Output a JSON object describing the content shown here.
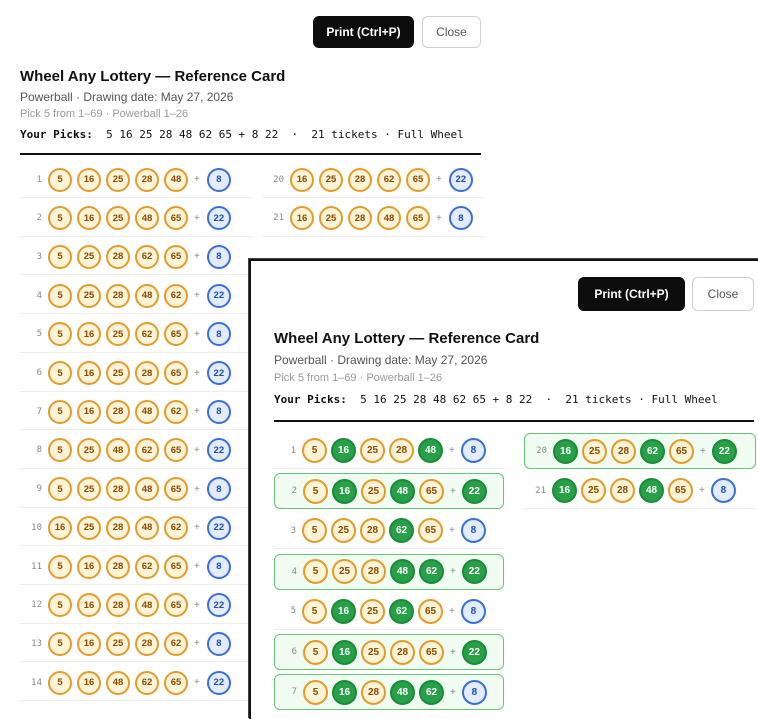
{
  "toolbar": {
    "print_label": "Print (Ctrl+P)",
    "close_label": "Close"
  },
  "card": {
    "title": "Wheel Any Lottery — Reference Card",
    "subtitle": "Powerball · Drawing date: May 27, 2026",
    "rules": "Pick 5 from 1–69 · Powerball 1–26",
    "picks_label": "Your Picks:",
    "picks_value": "5 16 25 28 48 62 65 + 8 22",
    "picks_suffix": "·  21 tickets · Full Wheel"
  },
  "colors": {
    "white_ball_fill": "#fdf3d6",
    "white_ball_border": "#e19c2c",
    "match_ball_fill": "#27a048",
    "powerball_fill": "#e2ecfd",
    "powerball_border": "#3b6ed8",
    "highlight_border": "#6cc27a"
  },
  "back_tickets": [
    {
      "n": "1",
      "balls": [
        "5",
        "16",
        "25",
        "28",
        "48"
      ],
      "pb": "8"
    },
    {
      "n": "2",
      "balls": [
        "5",
        "16",
        "25",
        "48",
        "65"
      ],
      "pb": "22"
    },
    {
      "n": "3",
      "balls": [
        "5",
        "25",
        "28",
        "62",
        "65"
      ],
      "pb": "8"
    },
    {
      "n": "4",
      "balls": [
        "5",
        "25",
        "28",
        "48",
        "62"
      ],
      "pb": "22"
    },
    {
      "n": "5",
      "balls": [
        "5",
        "16",
        "25",
        "62",
        "65"
      ],
      "pb": "8"
    },
    {
      "n": "6",
      "balls": [
        "5",
        "16",
        "25",
        "28",
        "65"
      ],
      "pb": "22"
    },
    {
      "n": "7",
      "balls": [
        "5",
        "16",
        "28",
        "48",
        "62"
      ],
      "pb": "8"
    },
    {
      "n": "8",
      "balls": [
        "5",
        "25",
        "48",
        "62",
        "65"
      ],
      "pb": "22"
    },
    {
      "n": "9",
      "balls": [
        "5",
        "25",
        "28",
        "48",
        "65"
      ],
      "pb": "8"
    },
    {
      "n": "10",
      "balls": [
        "16",
        "25",
        "28",
        "48",
        "62"
      ],
      "pb": "22"
    },
    {
      "n": "11",
      "balls": [
        "5",
        "16",
        "28",
        "62",
        "65"
      ],
      "pb": "8"
    },
    {
      "n": "12",
      "balls": [
        "5",
        "16",
        "28",
        "48",
        "65"
      ],
      "pb": "22"
    },
    {
      "n": "13",
      "balls": [
        "5",
        "16",
        "25",
        "28",
        "62"
      ],
      "pb": "8"
    },
    {
      "n": "14",
      "balls": [
        "5",
        "16",
        "48",
        "62",
        "65"
      ],
      "pb": "22"
    }
  ],
  "back_tickets_col2": [
    {
      "n": "20",
      "balls": [
        "16",
        "25",
        "28",
        "62",
        "65"
      ],
      "pb": "22"
    },
    {
      "n": "21",
      "balls": [
        "16",
        "25",
        "28",
        "48",
        "65"
      ],
      "pb": "8"
    }
  ],
  "front_tickets": [
    {
      "n": "1",
      "balls": [
        {
          "v": "5",
          "m": false
        },
        {
          "v": "16",
          "m": true
        },
        {
          "v": "25",
          "m": false
        },
        {
          "v": "28",
          "m": false
        },
        {
          "v": "48",
          "m": true
        }
      ],
      "pb": "8",
      "pbm": false,
      "hl": false
    },
    {
      "n": "2",
      "balls": [
        {
          "v": "5",
          "m": false
        },
        {
          "v": "16",
          "m": true
        },
        {
          "v": "25",
          "m": false
        },
        {
          "v": "48",
          "m": true
        },
        {
          "v": "65",
          "m": false
        }
      ],
      "pb": "22",
      "pbm": true,
      "hl": true
    },
    {
      "n": "3",
      "balls": [
        {
          "v": "5",
          "m": false
        },
        {
          "v": "25",
          "m": false
        },
        {
          "v": "28",
          "m": false
        },
        {
          "v": "62",
          "m": true
        },
        {
          "v": "65",
          "m": false
        }
      ],
      "pb": "8",
      "pbm": false,
      "hl": false
    },
    {
      "n": "4",
      "balls": [
        {
          "v": "5",
          "m": false
        },
        {
          "v": "25",
          "m": false
        },
        {
          "v": "28",
          "m": false
        },
        {
          "v": "48",
          "m": true
        },
        {
          "v": "62",
          "m": true
        }
      ],
      "pb": "22",
      "pbm": true,
      "hl": true
    },
    {
      "n": "5",
      "balls": [
        {
          "v": "5",
          "m": false
        },
        {
          "v": "16",
          "m": true
        },
        {
          "v": "25",
          "m": false
        },
        {
          "v": "62",
          "m": true
        },
        {
          "v": "65",
          "m": false
        }
      ],
      "pb": "8",
      "pbm": false,
      "hl": false
    },
    {
      "n": "6",
      "balls": [
        {
          "v": "5",
          "m": false
        },
        {
          "v": "16",
          "m": true
        },
        {
          "v": "25",
          "m": false
        },
        {
          "v": "28",
          "m": false
        },
        {
          "v": "65",
          "m": false
        }
      ],
      "pb": "22",
      "pbm": true,
      "hl": true
    },
    {
      "n": "7",
      "balls": [
        {
          "v": "5",
          "m": false
        },
        {
          "v": "16",
          "m": true
        },
        {
          "v": "28",
          "m": false
        },
        {
          "v": "48",
          "m": true
        },
        {
          "v": "62",
          "m": true
        }
      ],
      "pb": "8",
      "pbm": false,
      "hl": true
    }
  ],
  "front_tickets_col2": [
    {
      "n": "20",
      "balls": [
        {
          "v": "16",
          "m": true
        },
        {
          "v": "25",
          "m": false
        },
        {
          "v": "28",
          "m": false
        },
        {
          "v": "62",
          "m": true
        },
        {
          "v": "65",
          "m": false
        }
      ],
      "pb": "22",
      "pbm": true,
      "hl": true
    },
    {
      "n": "21",
      "balls": [
        {
          "v": "16",
          "m": true
        },
        {
          "v": "25",
          "m": false
        },
        {
          "v": "28",
          "m": false
        },
        {
          "v": "48",
          "m": true
        },
        {
          "v": "65",
          "m": false
        }
      ],
      "pb": "8",
      "pbm": false,
      "hl": false
    }
  ]
}
